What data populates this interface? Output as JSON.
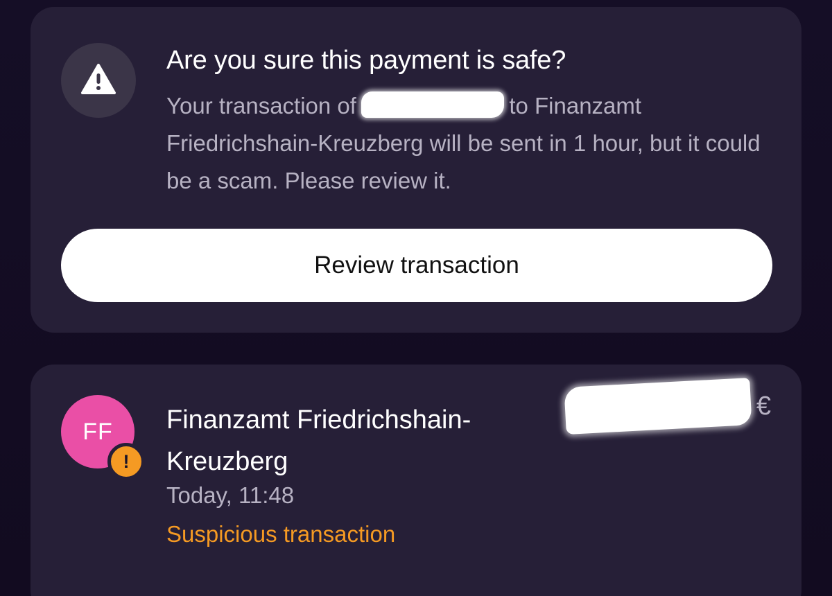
{
  "alert": {
    "icon": "warning-triangle-icon",
    "title": "Are you sure this payment is safe?",
    "body_prefix": "Your transaction of",
    "body_suffix": "to Finanzamt Friedrichshain-Kreuzberg will be sent in 1 hour, but it could be a scam. Please review it.",
    "review_button_label": "Review transaction"
  },
  "transaction": {
    "avatar_initials": "FF",
    "badge_icon": "exclamation-badge-icon",
    "badge_glyph": "!",
    "merchant_name": "Finanzamt Friedrichshain-Kreuzberg",
    "currency_symbol": "€",
    "time": "Today, 11:48",
    "status": "Suspicious transaction"
  },
  "colors": {
    "background": "#130d22",
    "card": "#261f37",
    "avatar": "#ea4fa6",
    "warning": "#f59a23",
    "muted_text": "#b7b2c3"
  }
}
